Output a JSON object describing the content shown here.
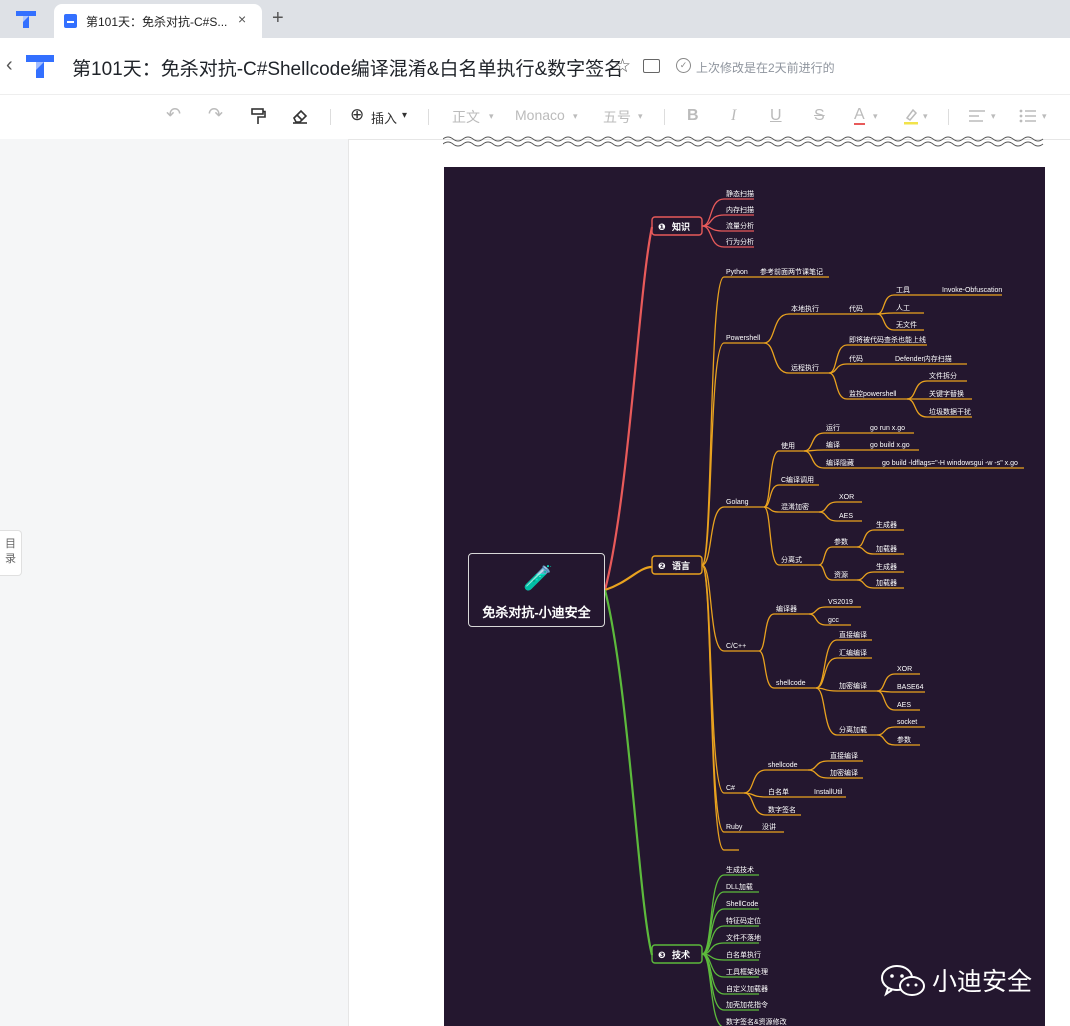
{
  "browser": {
    "tab_title": "第101天：免杀对抗-C#S...",
    "tab_close": "×",
    "new_tab": "+"
  },
  "header": {
    "back": "‹",
    "title": "第101天：免杀对抗-C#Shellcode编译混淆&白名单执行&数字签名",
    "star": "☆",
    "modified_check": "✓",
    "modified": "上次修改是在2天前进行的"
  },
  "toolbar": {
    "undo": "↶",
    "redo": "↷",
    "format_painter": "format-painter-icon",
    "eraser": "eraser-icon",
    "insert_icon": "⊕",
    "insert_label": "插入",
    "insert_caret": "▾",
    "style": "正文",
    "font": "Monaco",
    "size": "五号",
    "caret": "▾",
    "bold": "B",
    "italic": "I",
    "underline": "U",
    "strike": "S",
    "font_color": "A",
    "highlight": "highlight-icon",
    "align": "align-icon",
    "list": "list-icon"
  },
  "sidebar": {
    "toc_label": "目录"
  },
  "mindmap": {
    "center": "免杀对抗-小迪安全",
    "branches": {
      "knowledge": "知识",
      "language": "语言",
      "technique": "技术"
    },
    "badges": [
      "❶",
      "❷",
      "❸"
    ],
    "knowledge_items": [
      "静态扫描",
      "内存扫描",
      "流量分析",
      "行为分析"
    ],
    "python": {
      "name": "Python",
      "note": "参考前面两节课笔记"
    },
    "powershell": {
      "name": "Powershell",
      "local": "本地执行",
      "code": "代码",
      "tool": "工具",
      "tool_name": "Invoke-Obfuscation",
      "manual": "人工",
      "no_file": "无文件",
      "remote": "远程执行",
      "remote_item1": "即将被代码查杀也能上线",
      "remote_code": "代码",
      "defender": "Defender内存扫描",
      "listen": "监控powershell",
      "file_split": "文件拆分",
      "keyword_replace": "关键字替换",
      "junk_data": "垃圾数据干扰"
    },
    "golang": {
      "name": "Golang",
      "usage": "使用",
      "run": "运行",
      "run_cmd": "go run x.go",
      "compile": "编译",
      "compile_cmd": "go build x.go",
      "compile_hide": "编译隐藏",
      "hide_cmd": "go build -ldflags=\"-H windowsgui -w -s\" x.go",
      "c_call": "C编译调用",
      "encrypt": "混淆加密",
      "xor": "XOR",
      "aes": "AES",
      "separate": "分离式",
      "param": "参数",
      "generator": "生成器",
      "loader": "加载器",
      "resource": "资源",
      "generator2": "生成器",
      "loader2": "加载器"
    },
    "cpp": {
      "name": "C/C++",
      "compiler": "编译器",
      "vs": "VS2019",
      "gcc": "gcc",
      "shellcode": "shellcode",
      "direct": "直接编译",
      "asm": "汇编编译",
      "enc_compile": "加密编译",
      "xor": "XOR",
      "base64": "BASE64",
      "aes": "AES",
      "sep_load": "分离加载",
      "socket": "socket",
      "param": "参数"
    },
    "csharp": {
      "name": "C#",
      "shellcode": "shellcode",
      "direct": "直接编译",
      "enc": "加密编译",
      "whitelist": "白名单",
      "installutil": "InstallUtil",
      "signature": "数字签名"
    },
    "ruby": {
      "name": "Ruby",
      "note": "没讲"
    },
    "tech_items": [
      "生成技术",
      "DLL加载",
      "ShellCode",
      "特征码定位",
      "文件不落地",
      "白名单执行",
      "工具框架处理",
      "自定义加载器",
      "加壳加花指令",
      "数字签名&资源修改"
    ]
  },
  "watermark": {
    "text": "小迪安全"
  },
  "colors": {
    "mm_bg": "#24172f",
    "branch_red": "#e85a5a",
    "branch_orange": "#e9a21f",
    "branch_green": "#5cba3c",
    "accent": "#3370ff"
  }
}
